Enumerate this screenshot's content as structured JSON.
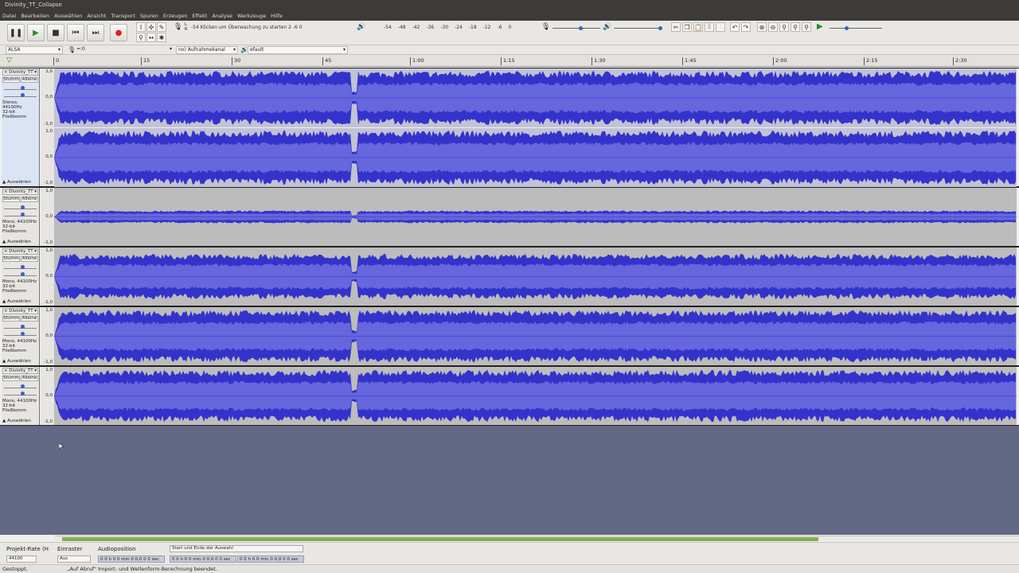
{
  "window": {
    "title": "Divinity_TT_Collapse"
  },
  "menu": [
    "Datei",
    "Bearbeiten",
    "Auswählen",
    "Ansicht",
    "Transport",
    "Spuren",
    "Erzeugen",
    "Effekt",
    "Analyse",
    "Werkzeuge",
    "Hilfe"
  ],
  "recording_meter": {
    "values": "-54   Klicken um Überwachung zu starten 2   -6   0",
    "l": "L",
    "r": "R"
  },
  "playback_meter": {
    "labels": [
      "-54",
      "-48",
      "-42",
      "-36",
      "-30",
      "-24",
      "-18",
      "-12",
      "-6",
      "0"
    ]
  },
  "device": {
    "host": "ALSA",
    "input": "=:0",
    "channels": "no) Aufnahmekanal",
    "output": "efault"
  },
  "ruler": {
    "labels": [
      "0",
      "15",
      "30",
      "45",
      "1:00",
      "1:15",
      "1:30",
      "1:45",
      "2:00",
      "2:15",
      "2:30"
    ]
  },
  "tracks": [
    {
      "name": "Divinity_TT",
      "mute": "Stumm",
      "solo": "Alleine",
      "format1": "Stereo, 44100Hz",
      "format2": "32-bit Fließkomm",
      "select": "Auswählen",
      "scale_top": "1,0",
      "scale_mid": "0,0",
      "scale_bot": "-1,0"
    },
    {
      "name": "Divinity_TT",
      "mute": "Stumm",
      "solo": "Alleine",
      "format1": "Mono, 44100Hz",
      "format2": "32-bit Fließkomm",
      "select": "Auswählen",
      "scale_top": "1,0",
      "scale_mid": "0,0",
      "scale_bot": "-1,0"
    },
    {
      "name": "Divinity_TT",
      "mute": "Stumm",
      "solo": "Alleine",
      "format1": "Mono, 44100Hz",
      "format2": "32-bit Fließkomm",
      "select": "Auswählen",
      "scale_top": "1,0",
      "scale_mid": "0,0",
      "scale_bot": "-1,0"
    },
    {
      "name": "Divinity_TT",
      "mute": "Stumm",
      "solo": "Alleine",
      "format1": "Mono, 44100Hz",
      "format2": "32-bit Fließkomm",
      "select": "Auswählen",
      "scale_top": "1,0",
      "scale_mid": "0,0",
      "scale_bot": "-1,0"
    },
    {
      "name": "Divinity_TT",
      "mute": "Stumm",
      "solo": "Alleine",
      "format1": "Mono, 44100Hz",
      "format2": "32-bit Fließkomm",
      "select": "Auswählen",
      "scale_top": "1,0",
      "scale_mid": "0,0",
      "scale_bot": "-1,0"
    }
  ],
  "selection": {
    "rate_label": "Projekt-Rate (H",
    "rate_value": "44100",
    "snap_label": "Einraster",
    "snap_value": "Aus",
    "pos_label": "Audioposition",
    "pos_value": "0 0 h 0 0 min 0 0,0 0 0 sec",
    "range_label": "Start und Ende der Auswahl",
    "start_value": "0 0 h 0 0 min 0 0,0 0 0 sec",
    "end_value": "0 0 h 0 0 min 0 0,0 0 0 sec"
  },
  "status": {
    "left": "Gestoppt.",
    "right": "„Auf Abruf\" Import- und Wellenform-Berechnung beendet."
  },
  "colors": {
    "wave": "#3333cc",
    "wave_rms": "#6666dd",
    "background": "#636884"
  }
}
